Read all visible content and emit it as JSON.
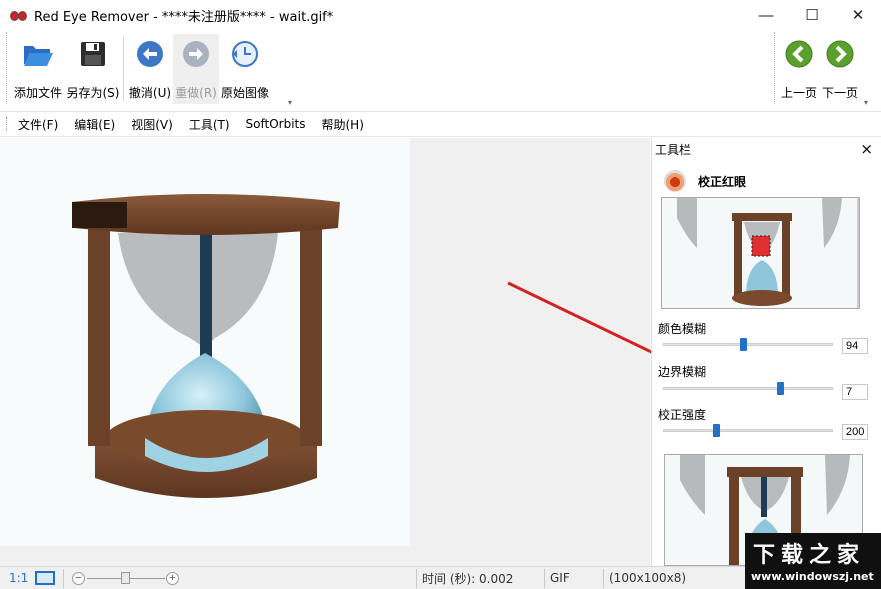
{
  "window": {
    "title": "Red Eye Remover - ****未注册版**** - wait.gif*",
    "minimize": "—",
    "maximize": "☐",
    "close": "✕"
  },
  "toolbar": {
    "add_file": "添加文件",
    "save_as": "另存为(S)",
    "undo": "撤消(U)",
    "redo": "重做(R)",
    "original": "原始图像",
    "prev_page": "上一页",
    "next_page": "下一页"
  },
  "menu": {
    "items": [
      "文件(F)",
      "编辑(E)",
      "视图(V)",
      "工具(T)",
      "SoftOrbits",
      "帮助(H)"
    ]
  },
  "panel": {
    "header": "工具栏",
    "close": "×",
    "section_title": "校正红眼",
    "sliders": [
      {
        "label": "颜色模糊",
        "value": "94",
        "position": 0.47
      },
      {
        "label": "边界模糊",
        "value": "7",
        "position": 0.69
      },
      {
        "label": "校正强度",
        "value": "200",
        "position": 0.31
      }
    ]
  },
  "statusbar": {
    "zoom_ratio": "1:1",
    "time": "时间 (秒): 0.002",
    "format": "GIF",
    "dimensions": "(100x100x8)"
  },
  "watermark": {
    "title": "下载之家",
    "url": "www.windowszj.net"
  },
  "colors": {
    "accent": "#1e73c8",
    "nav_green": "#5aa02c",
    "undo_blue": "#3d78c8",
    "annotation_arrow": "#d42020"
  }
}
